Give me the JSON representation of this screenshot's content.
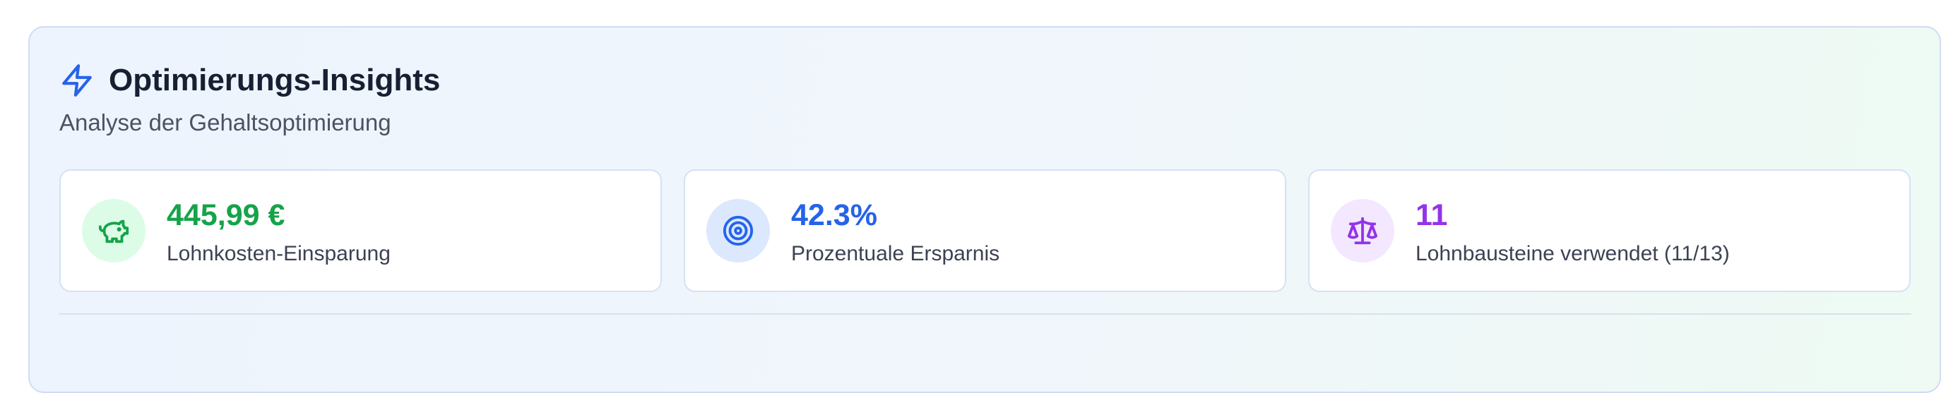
{
  "insights": {
    "title": "Optimierungs-Insights",
    "subtitle": "Analyse der Gehaltsoptimierung",
    "title_icon": "lightning-bolt-icon",
    "cards": [
      {
        "value": "445,99 €",
        "label": "Lohnkosten-Einsparung",
        "icon": "piggy-bank-icon",
        "accent_color": "#16a34a",
        "icon_bg": "#dcfce7"
      },
      {
        "value": "42.3%",
        "label": "Prozentuale Ersparnis",
        "icon": "target-icon",
        "accent_color": "#2563eb",
        "icon_bg": "#dbe8fe"
      },
      {
        "value": "11",
        "label": "Lohnbausteine verwendet (11/13)",
        "icon": "scale-icon",
        "accent_color": "#9333ea",
        "icon_bg": "#f3e8ff"
      }
    ]
  },
  "colors": {
    "title_icon": "#2563eb",
    "title_text": "#172033",
    "panel_border": "#cfdcf5"
  }
}
